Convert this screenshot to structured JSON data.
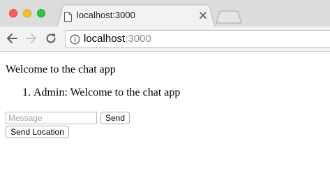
{
  "browser": {
    "tab": {
      "title": "localhost:3000"
    },
    "address_bar": {
      "host": "localhost",
      "port": ":3000"
    }
  },
  "page": {
    "heading": "Welcome to the chat app",
    "messages": [
      "Admin: Welcome to the chat app"
    ],
    "form": {
      "message_placeholder": "Message",
      "message_value": "",
      "send_label": "Send",
      "location_label": "Send Location"
    }
  },
  "colors": {
    "close": "#fc5f57",
    "minimize": "#fdbc2e",
    "maximize": "#28c840",
    "chrome_background": "#dcdcdc",
    "toolbar_background": "#f2f2f2"
  }
}
